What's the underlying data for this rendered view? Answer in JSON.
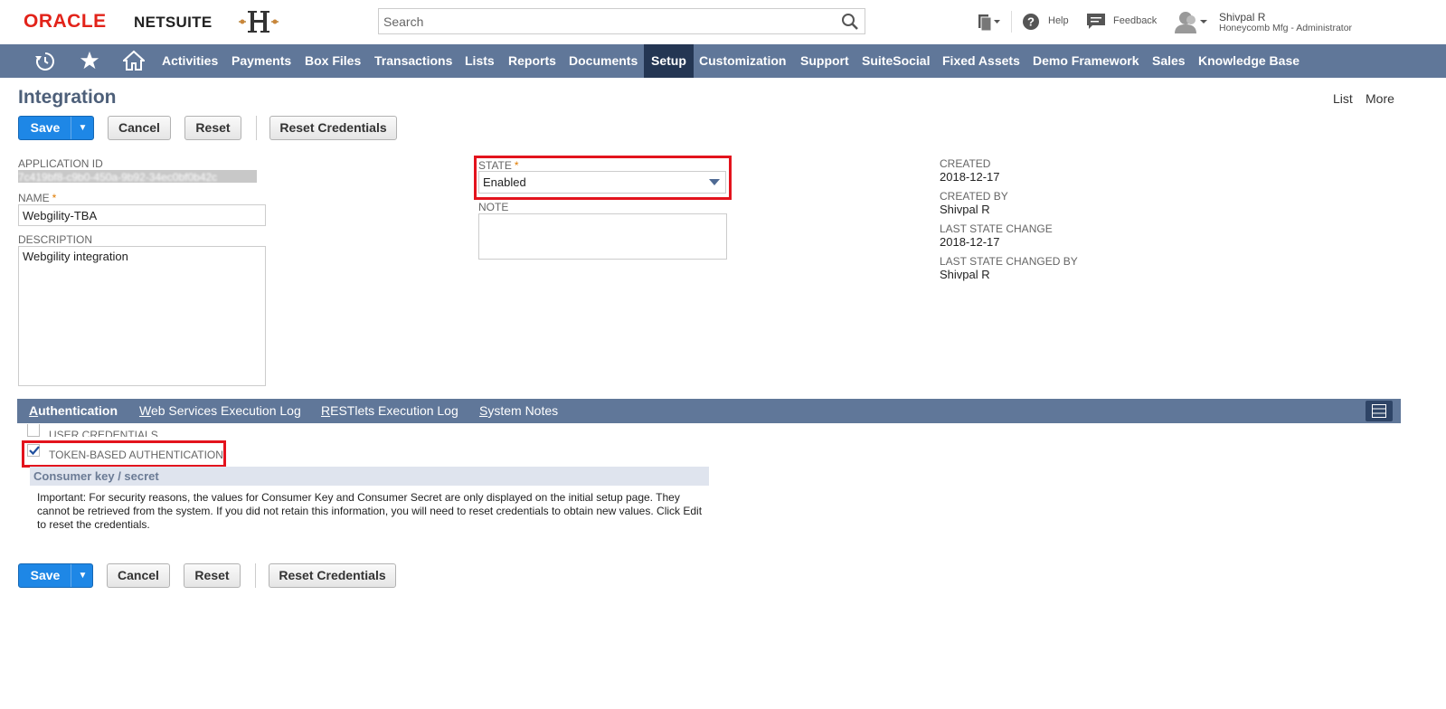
{
  "header": {
    "brand_oracle": "ORACLE",
    "brand_netsuite": "NETSUITE",
    "search_placeholder": "Search",
    "help_label": "Help",
    "feedback_label": "Feedback",
    "user_name": "Shivpal R",
    "user_role": "Honeycomb Mfg - Administrator"
  },
  "nav": {
    "items": [
      "Activities",
      "Payments",
      "Box Files",
      "Transactions",
      "Lists",
      "Reports",
      "Documents",
      "Setup",
      "Customization",
      "Support",
      "SuiteSocial",
      "Fixed Assets",
      "Demo Framework",
      "Sales",
      "Knowledge Base"
    ],
    "active": "Setup"
  },
  "page": {
    "title": "Integration",
    "list_link": "List",
    "more_link": "More"
  },
  "buttons": {
    "save": "Save",
    "cancel": "Cancel",
    "reset": "Reset",
    "reset_credentials": "Reset Credentials"
  },
  "form": {
    "application_id_label": "APPLICATION ID",
    "application_id_value": "7c419bf8-c9b0-450a-9b92-34ec0bf0b42c",
    "name_label": "NAME",
    "name_value": "Webgility-TBA",
    "description_label": "DESCRIPTION",
    "description_value": "Webgility integration",
    "state_label": "STATE",
    "state_value": "Enabled",
    "note_label": "NOTE",
    "note_value": "",
    "created_label": "CREATED",
    "created_value": "2018-12-17",
    "created_by_label": "CREATED BY",
    "created_by_value": "Shivpal R",
    "last_state_change_label": "LAST STATE CHANGE",
    "last_state_change_value": "2018-12-17",
    "last_state_changed_by_label": "LAST STATE CHANGED BY",
    "last_state_changed_by_value": "Shivpal R"
  },
  "subtabs": {
    "authentication": {
      "first": "A",
      "rest": "uthentication"
    },
    "ws_log": {
      "first": "W",
      "rest": "eb Services Execution Log"
    },
    "restlets_log": {
      "first": "R",
      "rest": "ESTlets Execution Log"
    },
    "system_notes": {
      "first": "S",
      "rest": "ystem Notes"
    }
  },
  "auth": {
    "user_credentials_label": "USER CREDENTIALS",
    "user_credentials_checked": false,
    "tba_label": "TOKEN-BASED AUTHENTICATION",
    "tba_checked": true,
    "section_title": "Consumer key / secret",
    "note": "Important: For security reasons, the values for Consumer Key and Consumer Secret are only displayed on the initial setup page. They cannot be retrieved from the system. If you did not retain this information, you will need to reset credentials to obtain new values. Click Edit to reset the credentials."
  },
  "colors": {
    "nav_bg": "#607799",
    "nav_active": "#243653",
    "save_blue": "#1e87e6",
    "highlight_red": "#e3131d",
    "title_color": "#4d5f79"
  }
}
